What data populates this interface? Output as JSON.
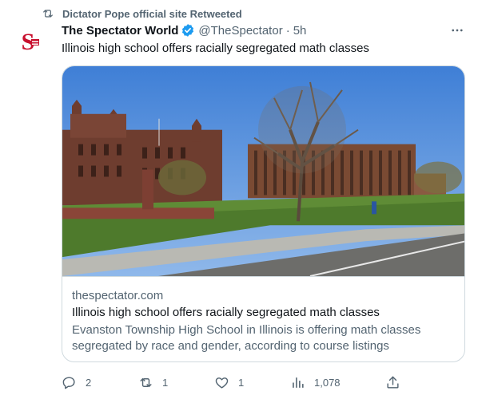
{
  "retweet": {
    "text": "Dictator Pope official site Retweeted",
    "icon": "retweet-icon"
  },
  "tweet": {
    "display_name": "The Spectator World",
    "handle": "@TheSpectator",
    "separator": "·",
    "time": "5h",
    "text": "Illinois high school offers racially segregated math classes",
    "verified_color": "#1d9bf0"
  },
  "card": {
    "domain": "thespectator.com",
    "title": "Illinois high school offers racially segregated math classes",
    "description": "Evanston Township High School in Illinois is offering math classes segregated by race and gender, according to course listings"
  },
  "actions": {
    "replies": "2",
    "retweets": "1",
    "likes": "1",
    "views": "1,078"
  },
  "colors": {
    "muted": "#536471",
    "text": "#0f1419",
    "border": "#cfd9de",
    "brand_red": "#c8102e"
  }
}
